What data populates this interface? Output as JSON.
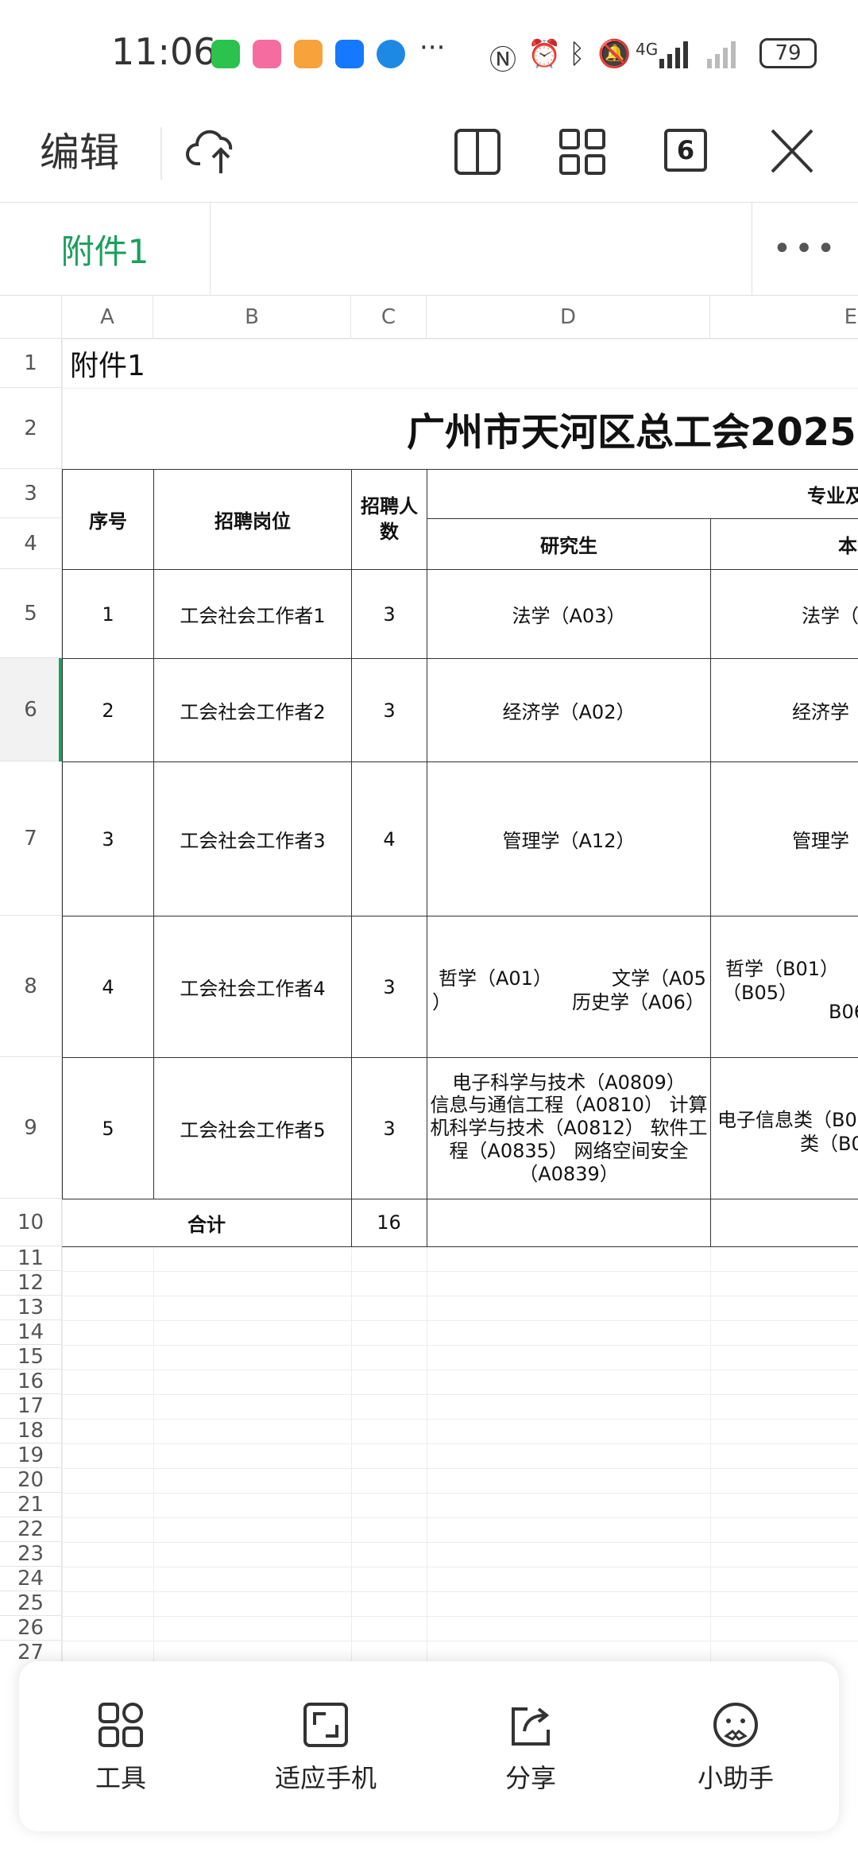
{
  "status_bar": {
    "time": "11:06",
    "net": "4G",
    "battery": "79"
  },
  "toolbar": {
    "edit_label": "编辑",
    "tab_count": "6"
  },
  "sheet_tabs": {
    "active": "附件1"
  },
  "columns": [
    "A",
    "B",
    "C",
    "D",
    "E"
  ],
  "rows": [
    "1",
    "2",
    "3",
    "4",
    "5",
    "6",
    "7",
    "8",
    "9",
    "10",
    "11",
    "12",
    "13",
    "14",
    "15",
    "16",
    "17",
    "18",
    "19",
    "20",
    "21",
    "22",
    "23",
    "24",
    "25",
    "26",
    "27"
  ],
  "sheet": {
    "a1": "附件1",
    "title": "广州市天河区总工会2025",
    "h_seq": "序号",
    "h_post": "招聘岗位",
    "h_count": "招聘人数",
    "h_major": "专业及",
    "h_grad": "研究生",
    "h_under": "本",
    "r5": {
      "a": "1",
      "b": "工会社会工作者1",
      "c": "3",
      "d": "法学（A03）",
      "e": "法学（"
    },
    "r6": {
      "a": "2",
      "b": "工会社会工作者2",
      "c": "3",
      "d": "经济学（A02）",
      "e": "经济学"
    },
    "r7": {
      "a": "3",
      "b": "工会社会工作者3",
      "c": "4",
      "d": "管理学（A12）",
      "e": "管理学"
    },
    "r8": {
      "a": "4",
      "b": "工会社会工作者4",
      "c": "3",
      "d1": "哲学（A01）",
      "d2": "文学（A05",
      "d3": "）",
      "d4": "历史学（A06）",
      "e1": "哲学（B01）",
      "e2": "（B05）",
      "e3": "B06"
    },
    "r9": {
      "a": "5",
      "b": "工会社会工作者5",
      "c": "3",
      "d1": "电子科学与技术（A0809）",
      "d2": "信息与通信工程（A0810） 计算",
      "d3": "机科学与技术（A0812） 软件工",
      "d4": "程（A0835）     网络空间安全",
      "d5": "（A0839）",
      "e1": "电子信息类（B08",
      "e2": "类（B0"
    },
    "total_label": "合计",
    "total_value": "16"
  },
  "bottom_bar": {
    "tools": "工具",
    "fit": "适应手机",
    "share": "分享",
    "assistant": "小助手"
  }
}
